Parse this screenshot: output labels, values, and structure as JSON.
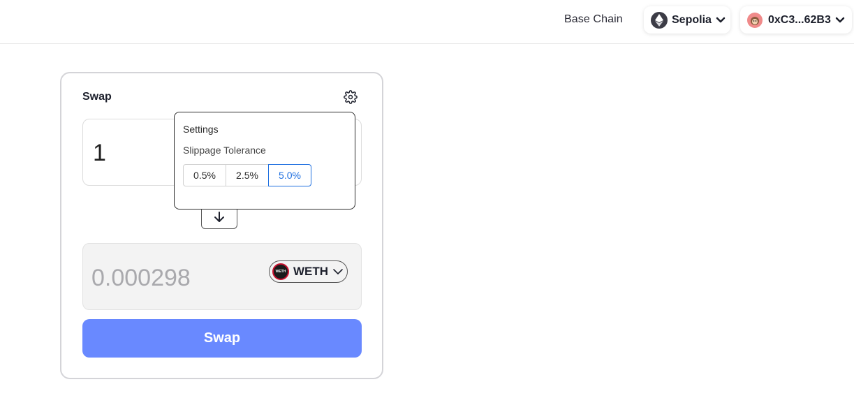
{
  "header": {
    "base_chain": "Base Chain",
    "network": {
      "label": "Sepolia",
      "icon": "ethereum-icon"
    },
    "account": {
      "address": "0xC3...62B3",
      "icon": "avatar-icon"
    }
  },
  "swap": {
    "title": "Swap",
    "input_amount": "1",
    "output_amount": "0.000298",
    "output_token": "WETH",
    "token_icon_text": "WETH",
    "swap_label": "Swap",
    "accent_color": "#6989ff"
  },
  "settings": {
    "title": "Settings",
    "slippage_label": "Slippage Tolerance",
    "options": [
      "0.5%",
      "2.5%",
      "5.0%"
    ],
    "selected": "5.0%",
    "selected_color": "#1e6fe0"
  }
}
